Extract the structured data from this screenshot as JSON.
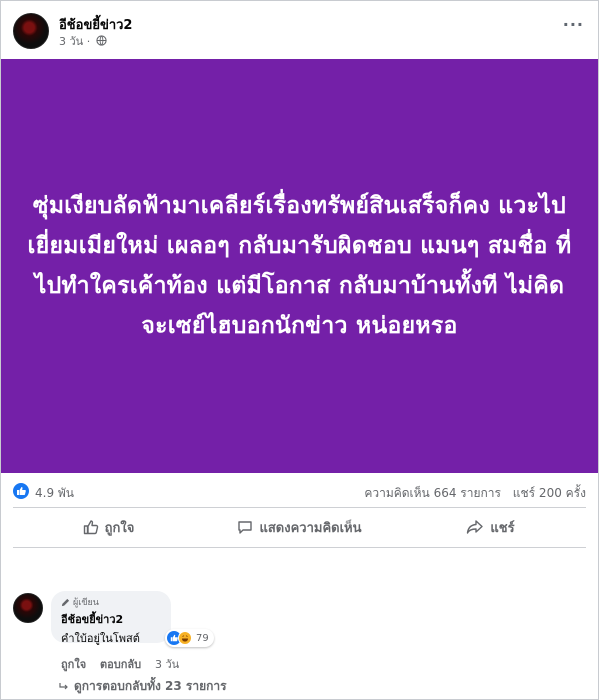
{
  "post": {
    "author": "อีช้อขยี้ข่าว2",
    "time": "3 วัน",
    "separator": "·",
    "more_label": "···",
    "text": "ซุ่มเงียบลัดฟ้ามาเคลียร์เรื่องทรัพย์สินเสร็จก็คง แวะไปเยี่ยมเมียใหม่ เผลอๆ กลับมารับผิดชอบ แมนๆ สมชื่อ ที่ไปทำใครเค้าท้อง แต่มีโอกาส กลับมาบ้านทั้งที ไม่คิดจะเซย์ไฮบอกนักข่าว หน่อยหรอ",
    "background_color": "#7420a8"
  },
  "stats": {
    "reactions": "4.9 พัน",
    "comments": "ความคิดเห็น 664 รายการ",
    "shares": "แชร์ 200 ครั้ง"
  },
  "actions": {
    "like": "ถูกใจ",
    "comment": "แสดงความคิดเห็น",
    "share": "แชร์"
  },
  "comment": {
    "badge": "ผู้เขียน",
    "author": "อีช้อขยี้ข่าว2",
    "text": "คำใบ้อยู่ในโพสต์",
    "reaction_count": "79",
    "like_label": "ถูกใจ",
    "reply_label": "ตอบกลับ",
    "time": "3 วัน",
    "view_replies": "ดูการตอบกลับทั้ง 23 รายการ"
  },
  "colors": {
    "accent": "#1877f2",
    "secondary_text": "#65676b"
  }
}
